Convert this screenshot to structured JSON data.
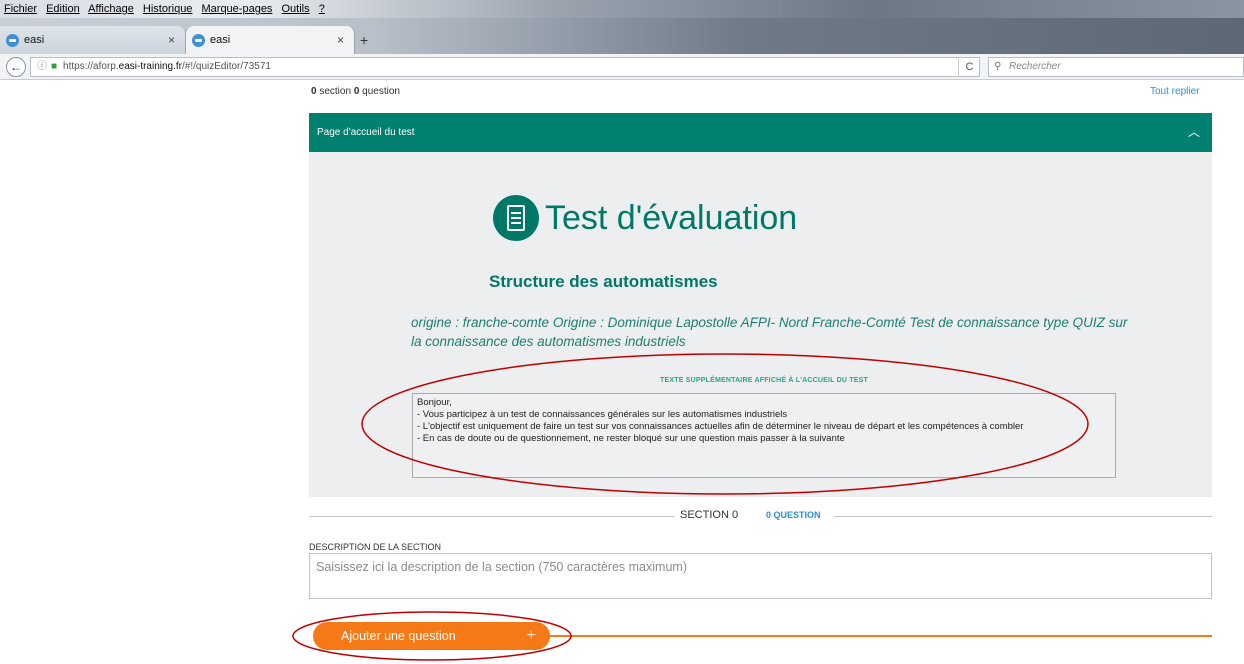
{
  "browser": {
    "menu": [
      "Fichier",
      "Edition",
      "Affichage",
      "Historique",
      "Marque-pages",
      "Outils",
      "?"
    ],
    "tabs": [
      {
        "label": "easi"
      },
      {
        "label": "easi"
      }
    ],
    "new_tab": "+",
    "tab_close": "×",
    "back": "←",
    "url_prefix": "https://aforp.",
    "url_host": "easi-training.fr",
    "url_suffix": "/#!/quizEditor/73571",
    "reload": "C",
    "search_placeholder": "Rechercher"
  },
  "toolbar": {
    "section_count": "0",
    "section_word": "section",
    "question_count": "0",
    "question_word": "question",
    "collapse_all": "Tout replier"
  },
  "welcome": {
    "header": "Page d'accueil du test",
    "title": "Test d'évaluation",
    "subtitle": "Structure des automatismes",
    "description": "origine : franche-comte Origine : Dominique Lapostolle AFPI- Nord Franche-Comté Test de connaissance type QUIZ sur la connaissance des automatismes industriels",
    "extra_label": "TEXTE SUPPLÉMENTAIRE AFFICHÉ À L'ACCUEIL DU TEST",
    "extra_lines": [
      "Bonjour,",
      "- Vous participez à un test de connaissances générales sur les automatismes industriels",
      "- L'objectif est uniquement de faire un test sur vos connaissances actuelles afin de déterminer le niveau de départ et les compétences à combler",
      "- En cas de doute ou de questionnement, ne rester bloqué sur une question mais passer à la suivante"
    ]
  },
  "section": {
    "title": "SECTION 0",
    "count": "0 QUESTION",
    "description_label": "DESCRIPTION DE LA SECTION",
    "description_placeholder": "Saisissez ici la description de la section (750 caractères maximum)",
    "add_question": "Ajouter une question",
    "add_plus": "+"
  },
  "colors": {
    "teal": "#007868",
    "header_teal": "#00806f",
    "orange": "#f57a17",
    "link_blue": "#2a8fd8",
    "annotation_red": "#c00000"
  }
}
